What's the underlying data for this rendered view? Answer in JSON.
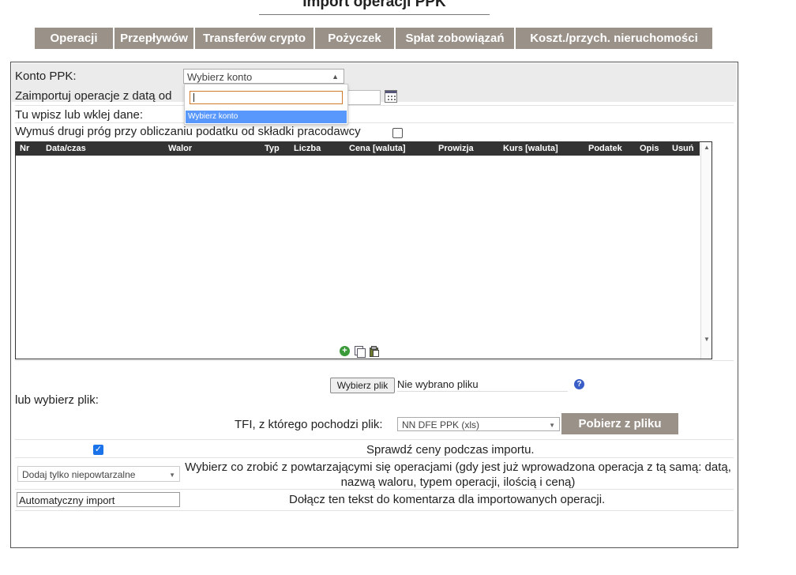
{
  "page_title": "Import operacji PPK",
  "tabs": [
    {
      "label": "Operacji"
    },
    {
      "label": "Przepływów"
    },
    {
      "label": "Transferów crypto"
    },
    {
      "label": "Pożyczek"
    },
    {
      "label": "Spłat zobowiązań"
    },
    {
      "label": "Koszt./przych. nieruchomości"
    }
  ],
  "form": {
    "account_label": "Konto PPK:",
    "account_selected": "Wybierz konto",
    "dropdown_option": "Wybierz konto",
    "import_date_label": "Zaimportuj operacje z datą od",
    "paste_label": "Tu wpisz lub wklej dane:",
    "force_threshold_label": "Wymuś drugi próg przy obliczaniu podatku od składki pracodawcy",
    "force_threshold_checked": false
  },
  "grid": {
    "columns": [
      "Nr",
      "Data/czas",
      "Walor",
      "Typ",
      "Liczba",
      "Cena [waluta]",
      "Prowizja",
      "Kurs [waluta]",
      "Podatek",
      "Opis",
      "Usuń"
    ],
    "rows": []
  },
  "file": {
    "choose_button": "Wybierz plik",
    "no_file": "Nie wybrano pliku",
    "or_choose_label": "lub wybierz plik:",
    "tfi_label": "TFI, z którego pochodzi plik:",
    "tfi_selected": "NN DFE PPK (xls)",
    "fetch_button": "Pobierz z pliku"
  },
  "options": {
    "check_prices_label": "Sprawdź ceny podczas importu.",
    "check_prices_checked": true,
    "duplicates_selected": "Dodaj tylko niepowtarzalne",
    "duplicates_text": "Wybierz co zrobić z powtarzającymi się operacjami (gdy jest już wprowadzona operacja z tą samą: datą, nazwą waloru, typem operacji, ilością i ceną)",
    "comment_value": "Automatyczny import",
    "comment_label": "Dołącz ten tekst do komentarza dla importowanych operacji."
  },
  "colors": {
    "tab_bg": "#9a9188",
    "grid_header_bg": "#333333",
    "option_highlight": "#5897fb",
    "checkbox": "#1a73e8"
  }
}
